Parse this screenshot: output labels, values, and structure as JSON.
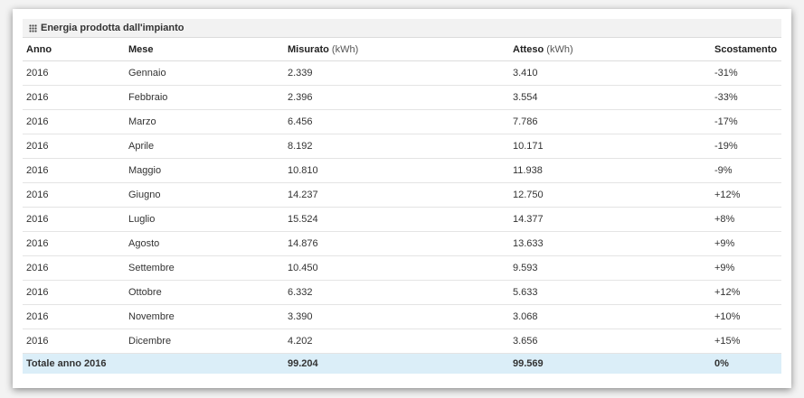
{
  "panel": {
    "title": "Energia prodotta dall'impianto"
  },
  "columns": {
    "anno": "Anno",
    "mese": "Mese",
    "misurato": "Misurato",
    "misurato_unit": " (kWh)",
    "atteso": "Atteso",
    "atteso_unit": " (kWh)",
    "scostamento": "Scostamento"
  },
  "rows": [
    {
      "anno": "2016",
      "mese": "Gennaio",
      "misurato": "2.339",
      "atteso": "3.410",
      "scostamento": "-31%"
    },
    {
      "anno": "2016",
      "mese": "Febbraio",
      "misurato": "2.396",
      "atteso": "3.554",
      "scostamento": "-33%"
    },
    {
      "anno": "2016",
      "mese": "Marzo",
      "misurato": "6.456",
      "atteso": "7.786",
      "scostamento": "-17%"
    },
    {
      "anno": "2016",
      "mese": "Aprile",
      "misurato": "8.192",
      "atteso": "10.171",
      "scostamento": "-19%"
    },
    {
      "anno": "2016",
      "mese": "Maggio",
      "misurato": "10.810",
      "atteso": "11.938",
      "scostamento": "-9%"
    },
    {
      "anno": "2016",
      "mese": "Giugno",
      "misurato": "14.237",
      "atteso": "12.750",
      "scostamento": "+12%"
    },
    {
      "anno": "2016",
      "mese": "Luglio",
      "misurato": "15.524",
      "atteso": "14.377",
      "scostamento": "+8%"
    },
    {
      "anno": "2016",
      "mese": "Agosto",
      "misurato": "14.876",
      "atteso": "13.633",
      "scostamento": "+9%"
    },
    {
      "anno": "2016",
      "mese": "Settembre",
      "misurato": "10.450",
      "atteso": "9.593",
      "scostamento": "+9%"
    },
    {
      "anno": "2016",
      "mese": "Ottobre",
      "misurato": "6.332",
      "atteso": "5.633",
      "scostamento": "+12%"
    },
    {
      "anno": "2016",
      "mese": "Novembre",
      "misurato": "3.390",
      "atteso": "3.068",
      "scostamento": "+10%"
    },
    {
      "anno": "2016",
      "mese": "Dicembre",
      "misurato": "4.202",
      "atteso": "3.656",
      "scostamento": "+15%"
    }
  ],
  "total": {
    "label": "Totale anno 2016",
    "misurato": "99.204",
    "atteso": "99.569",
    "scostamento": "0%"
  },
  "colors": {
    "total_row_bg": "#dbeef8",
    "header_bg": "#f2f2f2"
  },
  "icons": {
    "panel": "grid-icon"
  }
}
